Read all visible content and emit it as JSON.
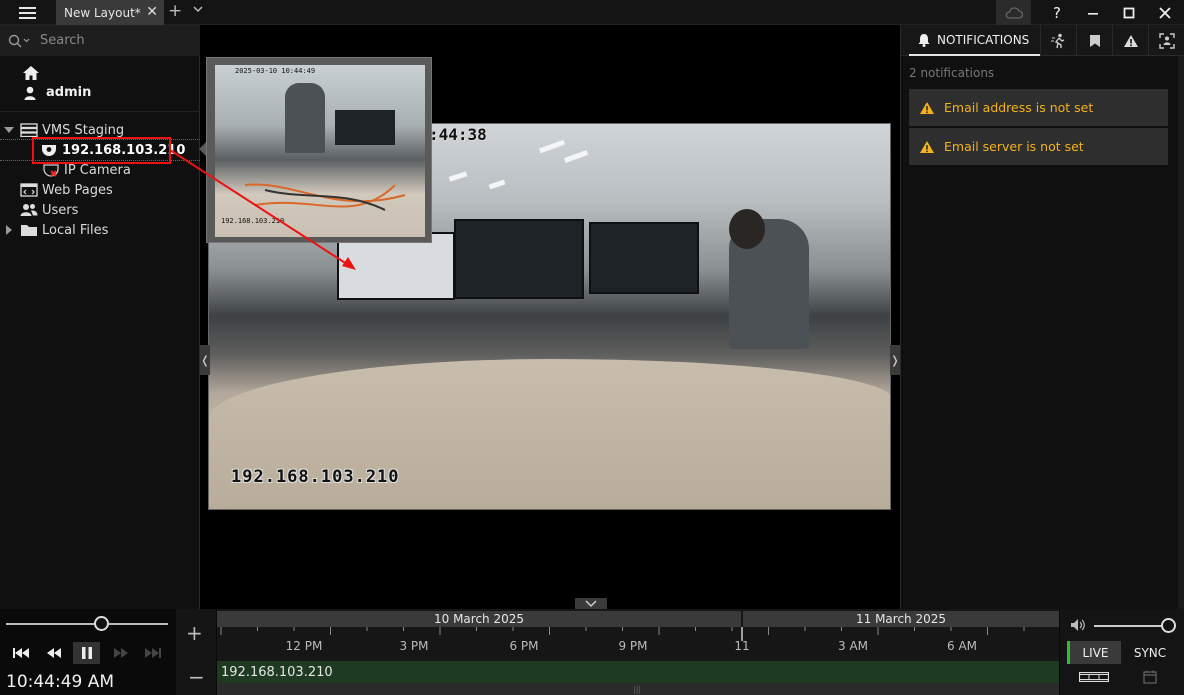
{
  "window": {
    "tab_title": "New Layout*",
    "help": "?"
  },
  "left": {
    "search_placeholder": "Search",
    "user": "admin",
    "tree": {
      "server": "VMS Staging",
      "camera_selected": "192.168.103.210",
      "camera_2": "IP Camera",
      "web_pages": "Web Pages",
      "users": "Users",
      "local_files": "Local Files"
    }
  },
  "preview": {
    "osd_top": "2025-03-10 10:44:49",
    "osd_bottom": "192.168.103.210"
  },
  "video": {
    "osd_time": ":44:38",
    "osd_ip": "192.168.103.210"
  },
  "notifications": {
    "tab_label": "NOTIFICATIONS",
    "count_text": "2 notifications",
    "items": [
      {
        "text": "Email address is not set"
      },
      {
        "text": "Email server is not set"
      }
    ],
    "warning_color": "#f3b21d"
  },
  "playback": {
    "clock": "10:44:49 AM"
  },
  "timeline": {
    "dates": [
      "10 March 2025",
      "11 March 2025"
    ],
    "labels": [
      "12 PM",
      "3 PM",
      "6 PM",
      "9 PM",
      "11",
      "3 AM",
      "6 AM"
    ],
    "track_label": "192.168.103.210",
    "track_color": "#1f3a22"
  },
  "right_controls": {
    "live": "LIVE",
    "sync": "SYNC",
    "live_indicator_color": "#2fbf2f"
  }
}
